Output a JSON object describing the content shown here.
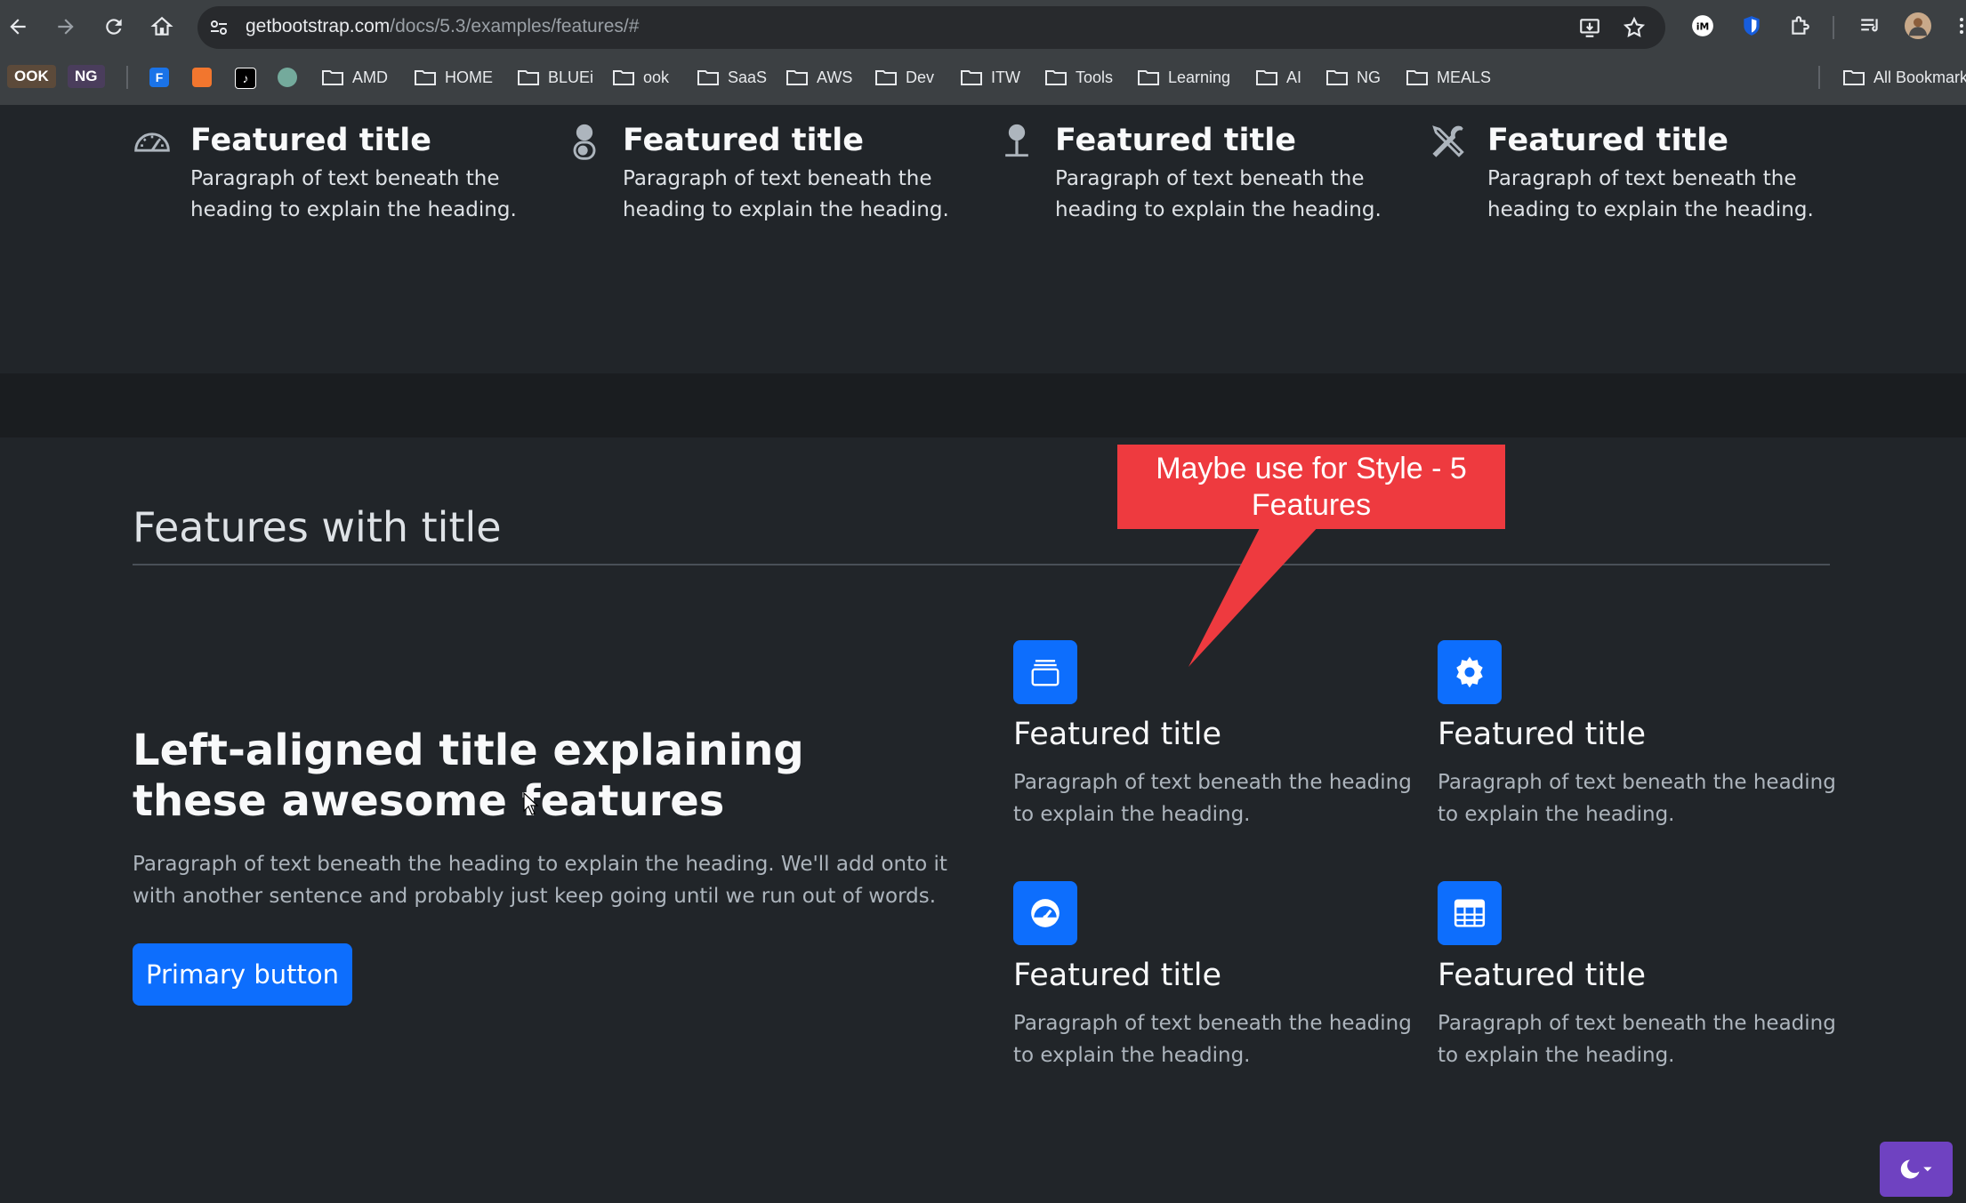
{
  "browser": {
    "url_host": "getbootstrap.com",
    "url_path": "/docs/5.3/examples/features/#",
    "bookmarks_tags": [
      "OOK",
      "NG"
    ],
    "bookmark_folders": [
      "AMD",
      "HOME",
      "BLUEi",
      "ook",
      "SaaS",
      "AWS",
      "Dev",
      "ITW",
      "Tools",
      "Learning",
      "AI",
      "NG",
      "MEALS"
    ],
    "all_bookmarks": "All Bookmarks",
    "favicon_f": "F"
  },
  "top_features": [
    {
      "icon": "speedometer-icon",
      "title": "Featured title",
      "text": "Paragraph of text beneath the heading to explain the heading."
    },
    {
      "icon": "toggles-icon",
      "title": "Featured title",
      "text": "Paragraph of text beneath the heading to explain the heading."
    },
    {
      "icon": "geo-pin-icon",
      "title": "Featured title",
      "text": "Paragraph of text beneath the heading to explain the heading."
    },
    {
      "icon": "tools-icon",
      "title": "Featured title",
      "text": "Paragraph of text beneath the heading to explain the heading."
    }
  ],
  "section": {
    "title": "Features with title",
    "left_title": "Left-aligned title explaining these awesome features",
    "left_text": "Paragraph of text beneath the heading to explain the heading. We'll add onto it with another sentence and probably just keep going until we run out of words.",
    "button": "Primary button"
  },
  "cards": [
    {
      "icon": "collection-icon",
      "title": "Featured title",
      "text": "Paragraph of text beneath the heading to explain the heading."
    },
    {
      "icon": "gear-icon",
      "title": "Featured title",
      "text": "Paragraph of text beneath the heading to explain the heading."
    },
    {
      "icon": "speedometer-icon",
      "title": "Featured title",
      "text": "Paragraph of text beneath the heading to explain the heading."
    },
    {
      "icon": "table-icon",
      "title": "Featured title",
      "text": "Paragraph of text beneath the heading to explain the heading."
    }
  ],
  "annotation": "Maybe use for Style - 5 Features",
  "colors": {
    "primary": "#0d6efd",
    "callout": "#ee3a3f",
    "theme_toggle": "#6f42c1",
    "body_bg": "#212529"
  }
}
